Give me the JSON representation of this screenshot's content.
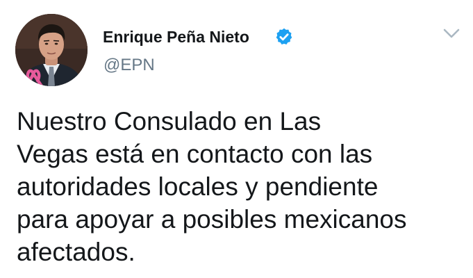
{
  "author": {
    "display_name": "Enrique Peña Nieto",
    "handle": "@EPN",
    "verified_icon": "verified-badge-icon",
    "avatar_icon": "profile-photo"
  },
  "menu": {
    "icon": "chevron-down-icon"
  },
  "tweet": {
    "lines": [
      "Nuestro Consulado en Las",
      "Vegas está en contacto con las",
      "autoridades locales y pendiente",
      "para apoyar a posibles mexicanos",
      "afectados."
    ]
  },
  "colors": {
    "text": "#14171a",
    "secondary": "#657786",
    "verified": "#1da1f2",
    "ribbon": "#e75a9b",
    "caret": "#aab8c2"
  }
}
